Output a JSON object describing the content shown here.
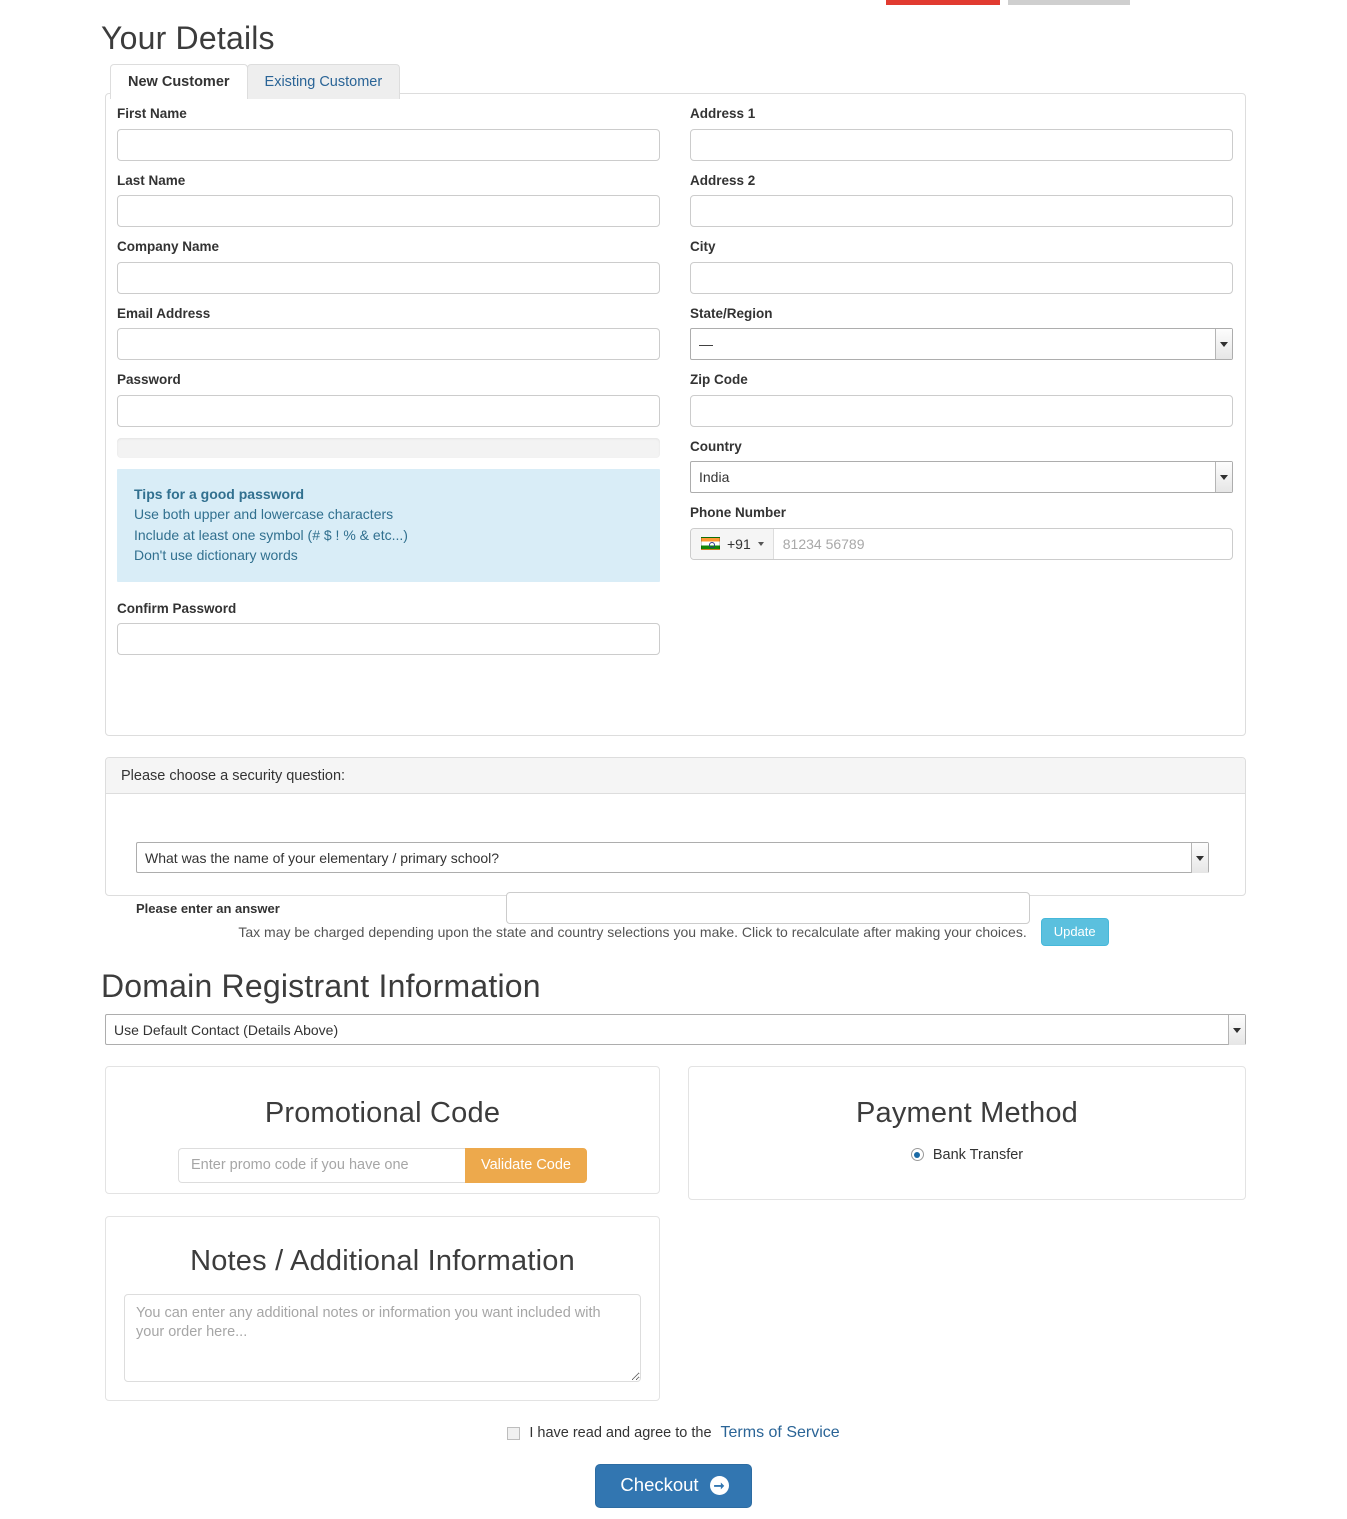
{
  "top_indicators": {
    "bar1_color": "#e13b30",
    "bar2_color": "#cfcfcf"
  },
  "your_details": {
    "heading": "Your Details",
    "tabs": [
      {
        "label": "New Customer",
        "active": true
      },
      {
        "label": "Existing Customer",
        "active": false
      }
    ],
    "left_fields": [
      {
        "name": "first-name",
        "label": "First Name",
        "value": "",
        "placeholder": ""
      },
      {
        "name": "last-name",
        "label": "Last Name",
        "value": "",
        "placeholder": ""
      },
      {
        "name": "company-name",
        "label": "Company Name",
        "value": "",
        "placeholder": ""
      },
      {
        "name": "email",
        "label": "Email Address",
        "value": "",
        "placeholder": ""
      },
      {
        "name": "password",
        "label": "Password",
        "value": "",
        "placeholder": ""
      }
    ],
    "password_strength": {
      "percent": 0,
      "track_color": "#f3f3f3"
    },
    "password_tips": {
      "title": "Tips for a good password",
      "lines": [
        "Use both upper and lowercase characters",
        "Include at least one symbol (# $ ! % & etc...)",
        "Don't use dictionary words"
      ],
      "background": "#d9edf7",
      "text_color": "#31708f"
    },
    "confirm_password": {
      "label": "Confirm Password",
      "value": ""
    },
    "right_fields": [
      {
        "name": "address-1",
        "label": "Address 1",
        "value": ""
      },
      {
        "name": "address-2",
        "label": "Address 2",
        "value": ""
      },
      {
        "name": "city",
        "label": "City",
        "value": ""
      }
    ],
    "state_region": {
      "label": "State/Region",
      "selected": "—"
    },
    "zip_code": {
      "label": "Zip Code",
      "value": ""
    },
    "country": {
      "label": "Country",
      "selected": "India"
    },
    "phone": {
      "label": "Phone Number",
      "flag_icon": "india-flag-icon",
      "dial_code": "+91",
      "placeholder": "81234 56789",
      "value": ""
    }
  },
  "security_question": {
    "panel_header": "Please choose a security question:",
    "selected": "What was the name of your elementary / primary school?",
    "answer_label": "Please enter an answer",
    "answer_value": "",
    "answer_placeholder": ""
  },
  "tax_notice": {
    "text": "Tax may be charged depending upon the state and country selections you make. Click to recalculate after making your choices.",
    "update_label": "Update",
    "update_color": "#5bc0de"
  },
  "registrant": {
    "heading": "Domain Registrant Information",
    "selected": "Use Default Contact (Details Above)"
  },
  "promo": {
    "title": "Promotional Code",
    "input_value": "",
    "input_placeholder": "Enter promo code if you have one",
    "button_label": "Validate Code",
    "button_color": "#eda94c"
  },
  "payment": {
    "title": "Payment Method",
    "options": [
      {
        "label": "Bank Transfer",
        "selected": true
      }
    ],
    "accent_color": "#1b6aa5"
  },
  "notes": {
    "title": "Notes / Additional Information",
    "value": "",
    "placeholder": "You can enter any additional notes or information you want included with your order here..."
  },
  "terms": {
    "checked": false,
    "text": "I have read and agree to the",
    "link_label": "Terms of Service",
    "link_color": "#2a6496"
  },
  "checkout": {
    "label": "Checkout",
    "arrow_icon": "arrow-right-circle-icon",
    "color": "#3276b1"
  }
}
